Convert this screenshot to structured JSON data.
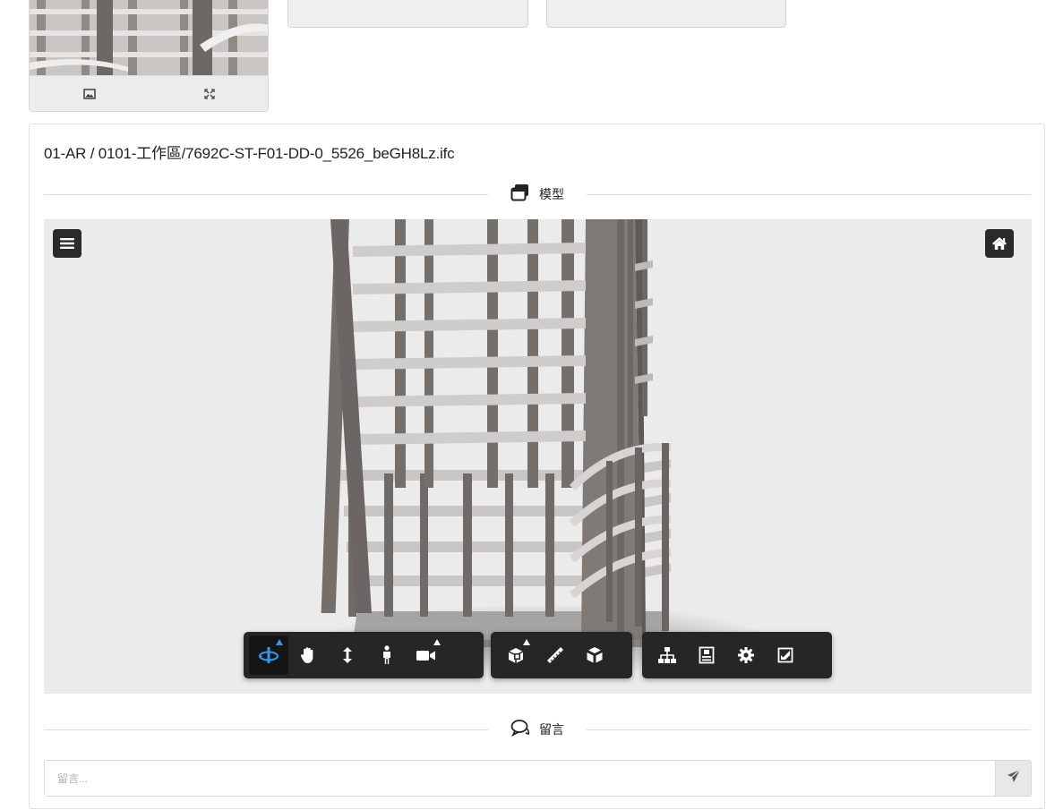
{
  "thumbnail": {
    "actions": [
      {
        "icon": "image-icon"
      },
      {
        "icon": "expand-icon"
      }
    ]
  },
  "file": {
    "path": "01-AR / 0101-工作區/7692C-ST-F01-DD-0_5526_beGH8Lz.ifc"
  },
  "model_section": {
    "label": "模型",
    "icon": "window-restore-icon"
  },
  "viewer": {
    "menu_icon": "hamburger-menu-icon",
    "home_icon": "home-icon",
    "toolbar_groups": [
      {
        "tools": [
          {
            "icon": "orbit-icon",
            "active": true,
            "has_submenu": true
          },
          {
            "icon": "pan-hand-icon",
            "active": false,
            "has_submenu": false
          },
          {
            "icon": "zoom-arrows-icon",
            "active": false,
            "has_submenu": false
          },
          {
            "icon": "first-person-icon",
            "active": false,
            "has_submenu": false
          },
          {
            "icon": "camera-icon",
            "active": false,
            "has_submenu": true
          }
        ]
      },
      {
        "tools": [
          {
            "icon": "section-box-icon",
            "active": false,
            "has_submenu": true
          },
          {
            "icon": "measure-ruler-icon",
            "active": false,
            "has_submenu": false
          },
          {
            "icon": "explode-cube-icon",
            "active": false,
            "has_submenu": false
          }
        ]
      },
      {
        "tools": [
          {
            "icon": "model-tree-icon",
            "active": false,
            "has_submenu": false
          },
          {
            "icon": "properties-icon",
            "active": false,
            "has_submenu": false
          },
          {
            "icon": "settings-gear-icon",
            "active": false,
            "has_submenu": false
          },
          {
            "icon": "fullscreen-icon",
            "active": false,
            "has_submenu": false
          }
        ]
      }
    ],
    "colors": {
      "toolbar_bg": "#262626",
      "active_accent": "#2b9cf2",
      "canvas_bg": "#ebebeb"
    }
  },
  "comments_section": {
    "label": "留言",
    "icon": "comments-icon",
    "input_placeholder": "留言...",
    "send_icon": "send-paper-plane-icon"
  }
}
